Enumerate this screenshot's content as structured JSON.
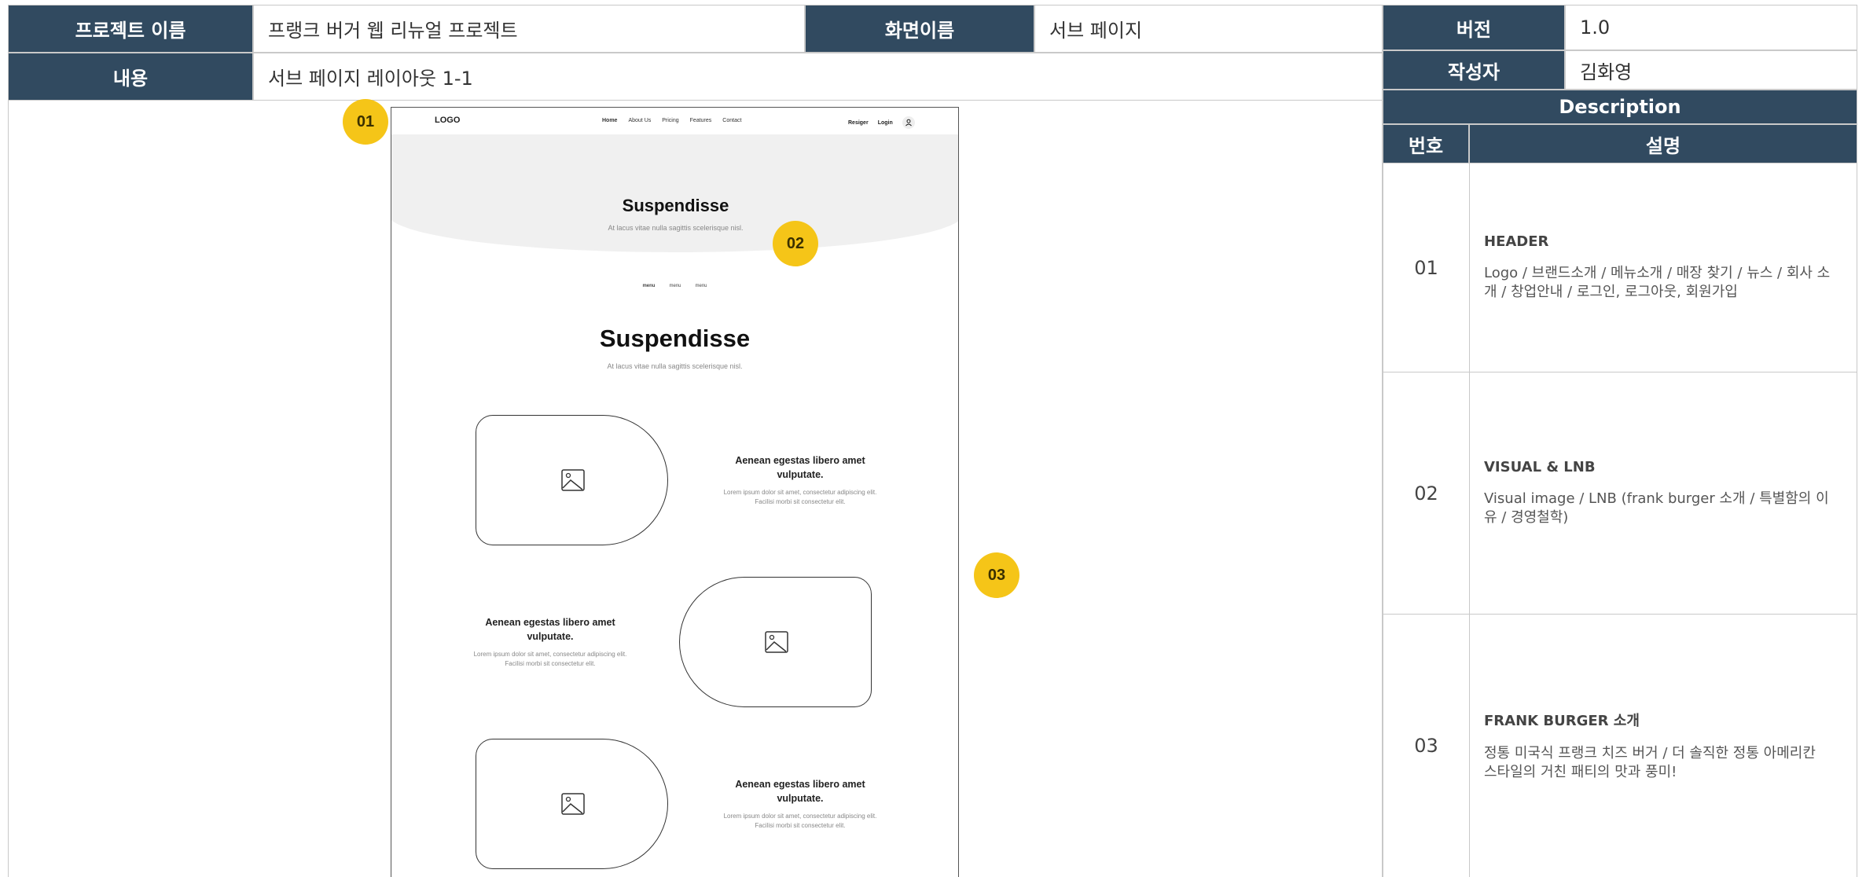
{
  "header": {
    "project_label": "프로젝트 이름",
    "project_value": "프랭크 버거 웹 리뉴얼 프로젝트",
    "screen_label": "화면이름",
    "screen_value": "서브 페이지",
    "content_label": "내용",
    "content_value": "서브 페이지 레이아웃 1-1",
    "version_label": "버전",
    "version_value": "1.0",
    "author_label": "작성자",
    "author_value": "김화영"
  },
  "description": {
    "title": "Description",
    "col_number": "번호",
    "col_desc": "설명",
    "rows": [
      {
        "number": "01",
        "title": "HEADER",
        "body": "Logo / 브랜드소개 / 메뉴소개 / 매장 찾기 / 뉴스 / 회사 소개 / 창업안내 / 로그인, 로그아웃, 회원가입"
      },
      {
        "number": "02",
        "title": "VISUAL & LNB",
        "body": "Visual image / LNB (frank burger 소개 / 특별함의 이유 / 경영철학)"
      },
      {
        "number": "03",
        "title": "FRANK BURGER 소개",
        "body": "정통 미국식 프랭크 치즈 버거 / 더 솔직한 정통 아메리칸 스타일의 거친 패티의 맛과 풍미!"
      }
    ]
  },
  "mockup": {
    "logo": "LOGO",
    "nav": [
      "Home",
      "About Us",
      "Pricing",
      "Features",
      "Contact"
    ],
    "register": "Resiger",
    "login": "Login",
    "visual_title": "Suspendisse",
    "visual_sub": "At lacus vitae nulla sagittis scelerisque nisl.",
    "lnb": [
      "menu",
      "menu",
      "menu"
    ],
    "section_title": "Suspendisse",
    "section_sub": "At lacus vitae nulla sagittis scelerisque nisl.",
    "features": [
      {
        "title": "Aenean egestas libero amet vulputate.",
        "desc": "Lorem ipsum dolor sit amet, consectetur adipiscing elit. Facilisi morbi sit consectetur elit."
      },
      {
        "title": "Aenean egestas libero amet vulputate.",
        "desc": "Lorem ipsum dolor sit amet, consectetur adipiscing elit. Facilisi morbi sit consectetur elit."
      },
      {
        "title": "Aenean egestas libero amet vulputate.",
        "desc": "Lorem ipsum dolor sit amet, consectetur adipiscing elit. Facilisi morbi sit consectetur elit."
      }
    ]
  },
  "badges": [
    "01",
    "02",
    "03"
  ],
  "colors": {
    "header_bg": "#314a60",
    "badge": "#f5c518"
  }
}
